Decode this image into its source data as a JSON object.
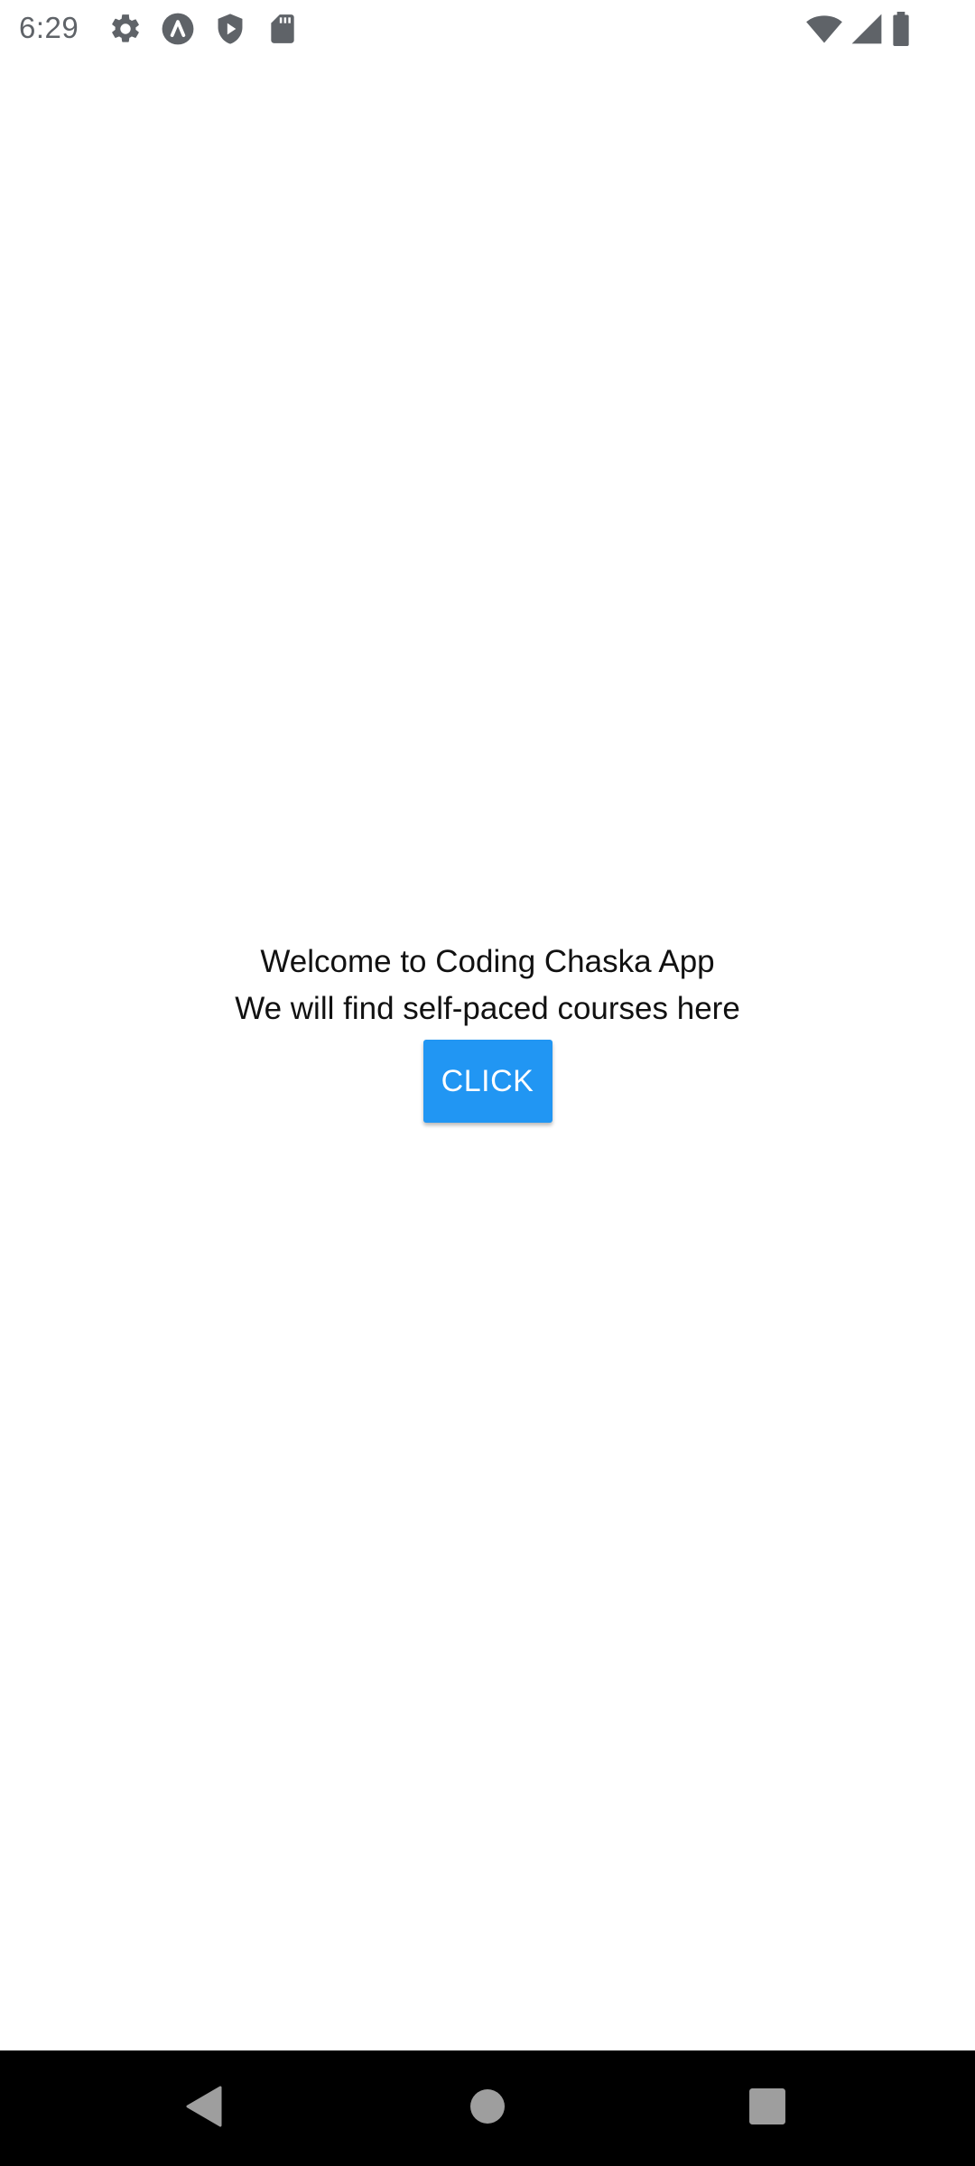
{
  "status_bar": {
    "time": "6:29",
    "left_icons": [
      "settings-gear-icon",
      "app-a-icon",
      "play-protect-icon",
      "sd-card-icon"
    ],
    "right_icons": [
      "wifi-icon",
      "cell-signal-icon",
      "battery-icon"
    ],
    "icon_color": "#5f6368"
  },
  "main": {
    "welcome_text": "Welcome to Coding Chaska App",
    "subtitle_text": "We will find self-paced courses here",
    "button_label": "CLICK",
    "button_color": "#2196f3"
  },
  "nav_bar": {
    "buttons": [
      "back-icon",
      "home-icon",
      "recents-icon"
    ],
    "background": "#000000"
  }
}
